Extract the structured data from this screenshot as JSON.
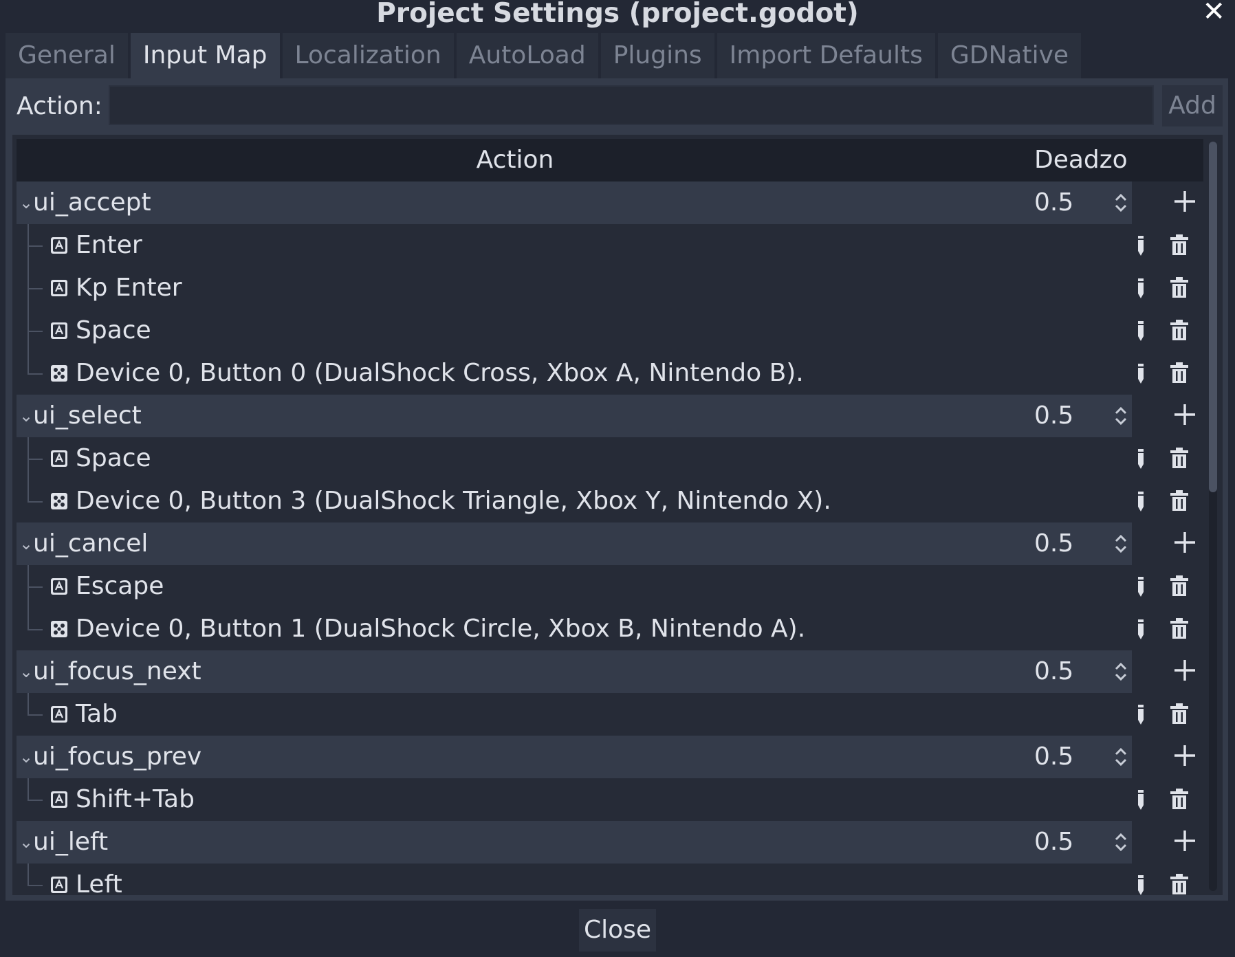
{
  "window": {
    "title": "Project Settings (project.godot)"
  },
  "tabs": [
    {
      "label": "General"
    },
    {
      "label": "Input Map"
    },
    {
      "label": "Localization"
    },
    {
      "label": "AutoLoad"
    },
    {
      "label": "Plugins"
    },
    {
      "label": "Import Defaults"
    },
    {
      "label": "GDNative"
    }
  ],
  "active_tab": "Input Map",
  "action_bar": {
    "label": "Action:",
    "value": "",
    "add_label": "Add"
  },
  "tree": {
    "headers": {
      "action": "Action",
      "deadzone": "Deadzo"
    },
    "groups": [
      {
        "name": "ui_accept",
        "deadzone": "0.5",
        "events": [
          {
            "type": "key",
            "label": "Enter"
          },
          {
            "type": "key",
            "label": "Kp Enter"
          },
          {
            "type": "key",
            "label": "Space"
          },
          {
            "type": "joypad",
            "label": "Device 0, Button 0 (DualShock Cross, Xbox A, Nintendo B)."
          }
        ]
      },
      {
        "name": "ui_select",
        "deadzone": "0.5",
        "events": [
          {
            "type": "key",
            "label": "Space"
          },
          {
            "type": "joypad",
            "label": "Device 0, Button 3 (DualShock Triangle, Xbox Y, Nintendo X)."
          }
        ]
      },
      {
        "name": "ui_cancel",
        "deadzone": "0.5",
        "events": [
          {
            "type": "key",
            "label": "Escape"
          },
          {
            "type": "joypad",
            "label": "Device 0, Button 1 (DualShock Circle, Xbox B, Nintendo A)."
          }
        ]
      },
      {
        "name": "ui_focus_next",
        "deadzone": "0.5",
        "events": [
          {
            "type": "key",
            "label": "Tab"
          }
        ]
      },
      {
        "name": "ui_focus_prev",
        "deadzone": "0.5",
        "events": [
          {
            "type": "key",
            "label": "Shift+Tab"
          }
        ]
      },
      {
        "name": "ui_left",
        "deadzone": "0.5",
        "events": [
          {
            "type": "key",
            "label": "Left"
          }
        ]
      }
    ]
  },
  "footer": {
    "close_label": "Close"
  },
  "colors": {
    "background": "#232835",
    "panel": "#343b4a",
    "tree_bg": "#262b37",
    "header_bg": "#1c202a",
    "text": "#e0e3ea",
    "muted_text": "#7d8493"
  }
}
